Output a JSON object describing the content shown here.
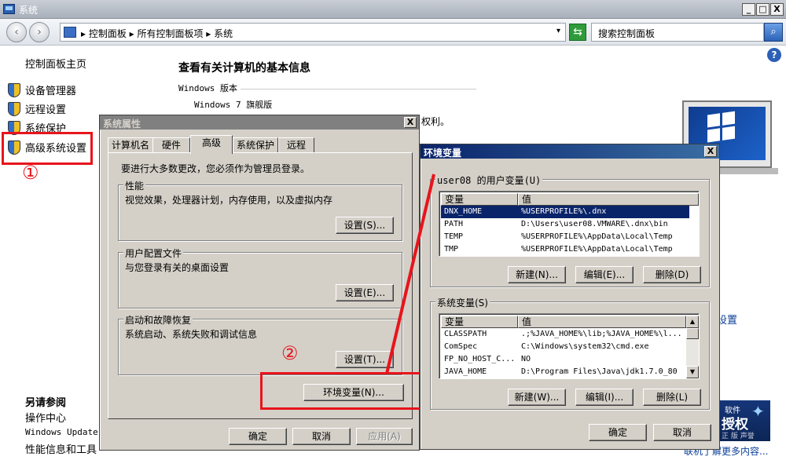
{
  "window": {
    "title": "系统",
    "min_label": "_",
    "max_label": "□",
    "close_label": "X"
  },
  "address": {
    "breadcrumb": "▸ 控制面板 ▸ 所有控制面板项 ▸ 系统",
    "dropdown_glyph": "▾",
    "refresh_glyph": "⇆",
    "search_placeholder": "搜索控制面板",
    "search_glyph": "⌕"
  },
  "nav": {
    "back_glyph": "‹",
    "forward_glyph": "›"
  },
  "left_panel": {
    "home": "控制面板主页",
    "items": [
      {
        "label": "设备管理器"
      },
      {
        "label": "远程设置"
      },
      {
        "label": "系统保护"
      },
      {
        "label": "高级系统设置"
      }
    ],
    "see_also_header": "另请参阅",
    "see_also": [
      {
        "label": "操作中心"
      },
      {
        "label": "Windows Update"
      },
      {
        "label": "性能信息和工具"
      }
    ]
  },
  "annotations": {
    "step1": "①",
    "step2": "②",
    "color": "#e8141c"
  },
  "content": {
    "title": "查看有关计算机的基本信息",
    "windows_version_label": "Windows 版本",
    "edition": "Windows 7 旗舰版",
    "fragment_rights": "权利。",
    "fragment_settings": "设置",
    "fragment_more": "联机了解更多内容...",
    "help_glyph": "?",
    "auth_badge": {
      "line1": "软件",
      "line2": "授权",
      "line3": "正 版 声誉",
      "star": "✦"
    }
  },
  "sysprop": {
    "title": "系统属性",
    "close_label": "X",
    "tabs": [
      {
        "label": "计算机名"
      },
      {
        "label": "硬件"
      },
      {
        "label": "高级"
      },
      {
        "label": "系统保护"
      },
      {
        "label": "远程"
      }
    ],
    "active_tab": "高级",
    "admin_note": "要进行大多数更改，您必须作为管理员登录。",
    "performance": {
      "label": "性能",
      "desc": "视觉效果，处理器计划，内存使用，以及虚拟内存",
      "button": "设置(S)..."
    },
    "user_profile": {
      "label": "用户配置文件",
      "desc": "与您登录有关的桌面设置",
      "button": "设置(E)..."
    },
    "startup": {
      "label": "启动和故障恢复",
      "desc": "系统启动、系统失败和调试信息",
      "button": "设置(T)..."
    },
    "env_button": "环境变量(N)...",
    "ok": "确定",
    "cancel": "取消",
    "apply": "应用(A)"
  },
  "envvars": {
    "title": "环境变量",
    "close_label": "X",
    "user_group_label": "user08 的用户变量(U)",
    "col_var": "变量",
    "col_val": "值",
    "user_vars": [
      {
        "name": "DNX_HOME",
        "value": "%USERPROFILE%\\.dnx",
        "selected": true
      },
      {
        "name": "PATH",
        "value": "D:\\Users\\user08.VMWARE\\.dnx\\bin"
      },
      {
        "name": "TEMP",
        "value": "%USERPROFILE%\\AppData\\Local\\Temp"
      },
      {
        "name": "TMP",
        "value": "%USERPROFILE%\\AppData\\Local\\Temp"
      }
    ],
    "user_new": "新建(N)...",
    "user_edit": "编辑(E)...",
    "user_delete": "删除(D)",
    "sys_group_label": "系统变量(S)",
    "sys_vars": [
      {
        "name": "CLASSPATH",
        "value": ".;%JAVA_HOME%\\lib;%JAVA_HOME%\\l..."
      },
      {
        "name": "ComSpec",
        "value": "C:\\Windows\\system32\\cmd.exe"
      },
      {
        "name": "FP_NO_HOST_C...",
        "value": "NO"
      },
      {
        "name": "JAVA_HOME",
        "value": "D:\\Program Files\\Java\\jdk1.7.0_80"
      }
    ],
    "sys_new": "新建(W)...",
    "sys_edit": "编辑(I)...",
    "sys_delete": "删除(L)",
    "ok": "确定",
    "cancel": "取消",
    "scroll_up": "▲",
    "scroll_down": "▼"
  }
}
